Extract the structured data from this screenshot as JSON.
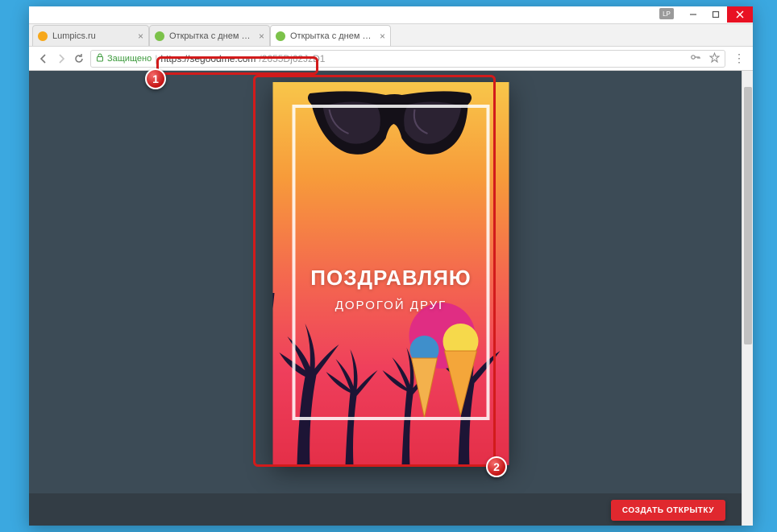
{
  "window": {
    "lp_badge": "LP"
  },
  "tabs": [
    {
      "label": "Lumpics.ru",
      "favicon_color": "#f7a81b"
    },
    {
      "label": "Открытка с днем рожде",
      "favicon_color": "#7cc24a"
    },
    {
      "label": "Открытка с днем рожде",
      "favicon_color": "#7cc24a"
    }
  ],
  "address": {
    "secure_label": "Защищено",
    "url_host": "https://segoodme.com",
    "url_path": "/2655Dj62JzD1"
  },
  "card": {
    "title": "ПОЗДРАВЛЯЮ",
    "subtitle": "ДОРОГОЙ ДРУГ"
  },
  "create_button": "СОЗДАТЬ ОТКРЫТКУ",
  "badges": {
    "one": "1",
    "two": "2"
  }
}
